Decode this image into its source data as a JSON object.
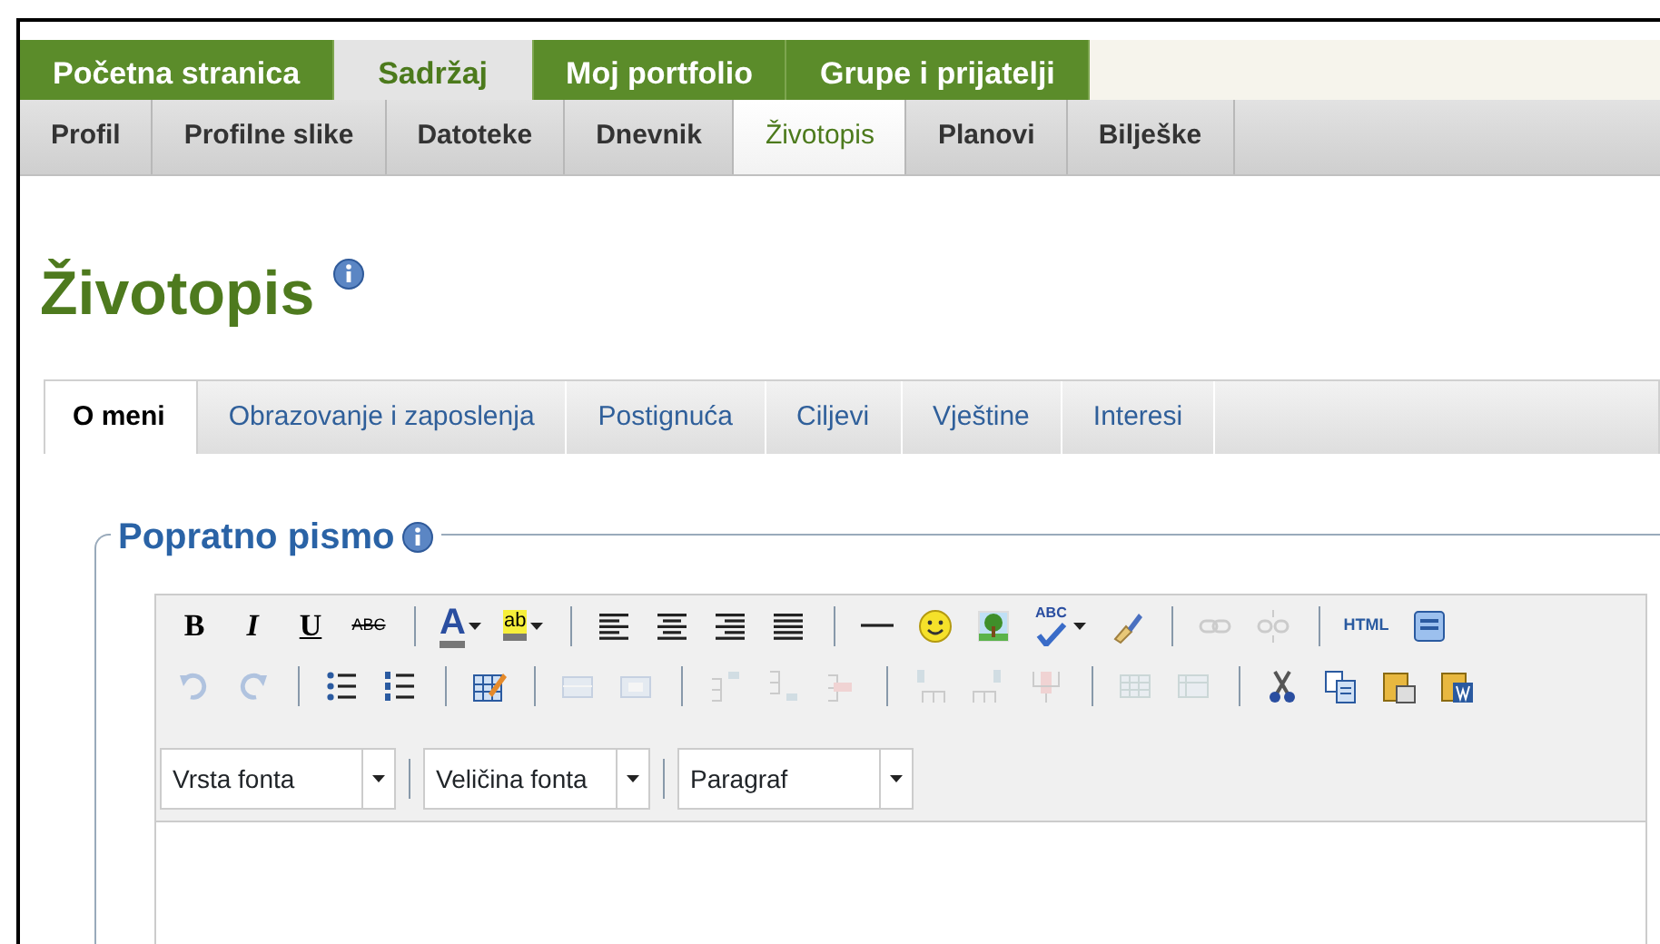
{
  "main_nav": [
    {
      "label": "Početna stranica",
      "selected": false
    },
    {
      "label": "Sadržaj",
      "selected": true
    },
    {
      "label": "Moj portfolio",
      "selected": false
    },
    {
      "label": "Grupe i prijatelji",
      "selected": false
    }
  ],
  "sub_nav": [
    {
      "label": "Profil",
      "selected": false
    },
    {
      "label": "Profilne slike",
      "selected": false
    },
    {
      "label": "Datoteke",
      "selected": false
    },
    {
      "label": "Dnevnik",
      "selected": false
    },
    {
      "label": "Životopis",
      "selected": true
    },
    {
      "label": "Planovi",
      "selected": false
    },
    {
      "label": "Bilješke",
      "selected": false
    }
  ],
  "page_title": "Životopis",
  "tabs": [
    {
      "label": "O meni",
      "selected": true
    },
    {
      "label": "Obrazovanje i zaposlenja",
      "selected": false
    },
    {
      "label": "Postignuća",
      "selected": false
    },
    {
      "label": "Ciljevi",
      "selected": false
    },
    {
      "label": "Vještine",
      "selected": false
    },
    {
      "label": "Interesi",
      "selected": false
    }
  ],
  "section": {
    "legend": "Popratno pismo",
    "editor": {
      "toolbar_rows": [
        [
          [
            {
              "label": "B",
              "disabled": false
            },
            {
              "label": "I",
              "disabled": false
            },
            {
              "label": "U",
              "disabled": false
            },
            {
              "label": "ABC",
              "disabled": false
            }
          ],
          [
            {
              "label": "A",
              "disabled": false,
              "dropdown": true
            },
            {
              "label": "ab",
              "disabled": false,
              "dropdown": true
            }
          ],
          [
            {
              "disabled": false
            },
            {
              "disabled": false
            },
            {
              "disabled": false
            },
            {
              "disabled": false
            }
          ],
          [
            {
              "disabled": false
            },
            {
              "disabled": false
            },
            {
              "disabled": false
            },
            {
              "label": "ABC",
              "disabled": false,
              "dropdown": true
            },
            {
              "disabled": false
            }
          ],
          [
            {
              "disabled": true
            },
            {
              "disabled": true
            }
          ],
          [
            {
              "label": "HTML",
              "disabled": false
            },
            {
              "disabled": false
            }
          ]
        ],
        [
          [
            {
              "disabled": true
            },
            {
              "disabled": true
            }
          ],
          [
            {
              "disabled": false
            },
            {
              "disabled": false
            }
          ],
          [
            {
              "disabled": false
            }
          ],
          [
            {
              "disabled": true
            },
            {
              "disabled": true
            }
          ],
          [
            {
              "disabled": true
            },
            {
              "disabled": true
            },
            {
              "disabled": true
            }
          ],
          [
            {
              "disabled": true
            },
            {
              "disabled": true
            },
            {
              "disabled": true
            }
          ],
          [
            {
              "disabled": true
            },
            {
              "disabled": true
            }
          ],
          [
            {
              "disabled": false
            },
            {
              "disabled": false
            },
            {
              "disabled": false
            },
            {
              "disabled": false
            }
          ]
        ]
      ],
      "selects": [
        {
          "value": "Vrsta fonta"
        },
        {
          "value": "Veličina fonta"
        },
        {
          "value": "Paragraf"
        }
      ]
    }
  }
}
